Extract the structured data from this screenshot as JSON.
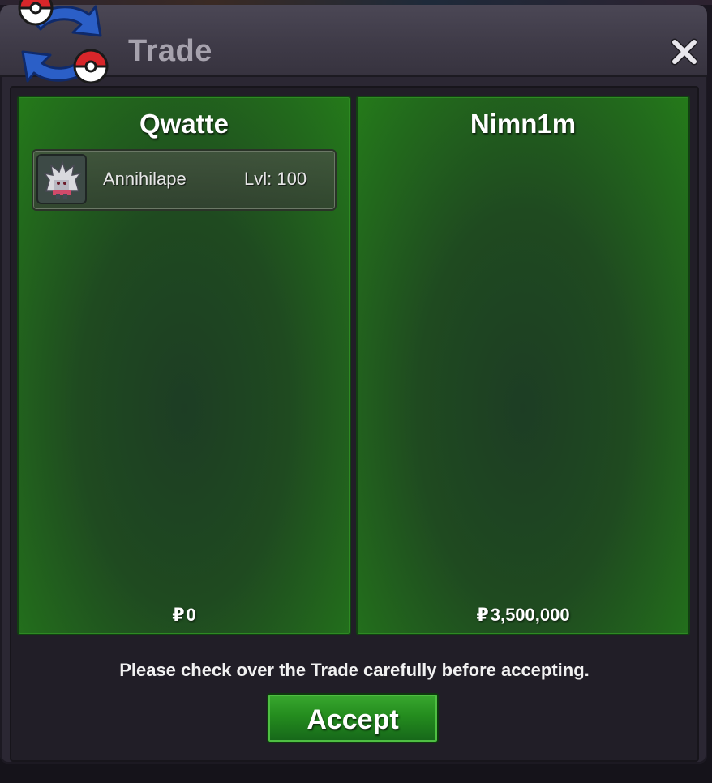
{
  "window": {
    "title": "Trade",
    "icon": "trade-swap-icon",
    "close_icon": "close-icon"
  },
  "left_panel": {
    "player_name": "Qwatte",
    "items": [
      {
        "name": "Annihilape",
        "level": "Lvl: 100",
        "icon": "annihilape-sprite-icon"
      }
    ],
    "money_symbol": "₽",
    "money": "0"
  },
  "right_panel": {
    "player_name": "Nimn1m",
    "items": [],
    "money_symbol": "₽",
    "money": "3,500,000"
  },
  "footer": {
    "notice": "Please check over the Trade carefully before accepting.",
    "accept_label": "Accept"
  },
  "colors": {
    "panel_green": "#247a1a",
    "accept_green": "#248c1e",
    "window_bg": "#2b2733"
  }
}
